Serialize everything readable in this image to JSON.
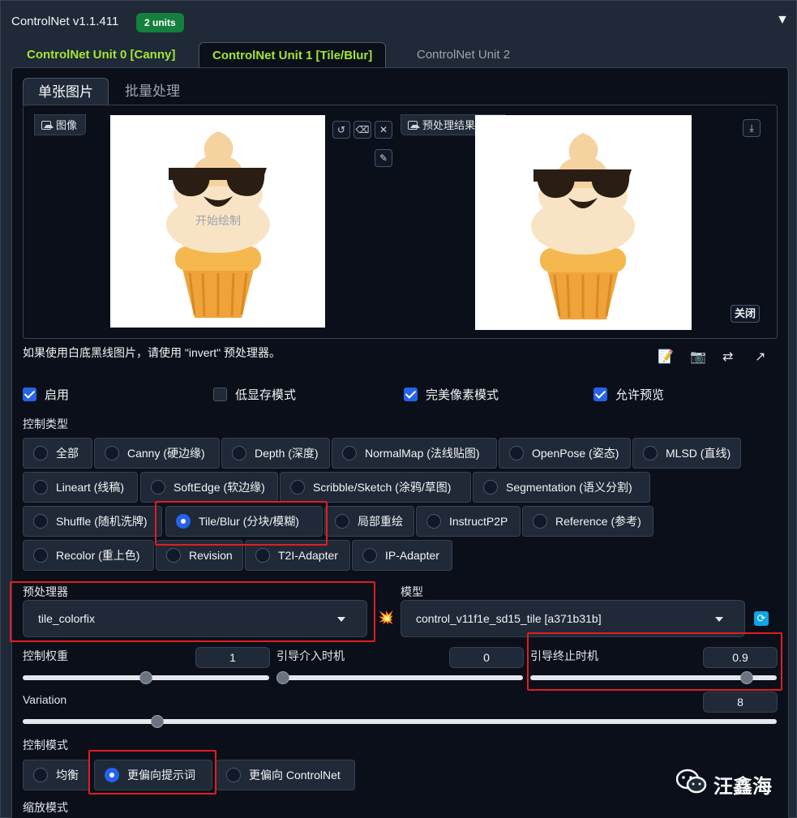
{
  "header": {
    "title": "ControlNet v1.1.411",
    "units_badge": "2 units",
    "collapse_icon": "▼"
  },
  "unit_tabs": [
    {
      "label": "ControlNet Unit 0 [Canny]"
    },
    {
      "label": "ControlNet Unit 1 [Tile/Blur]"
    },
    {
      "label": "ControlNet Unit 2"
    }
  ],
  "image_tabs": [
    {
      "label": "单张图片"
    },
    {
      "label": "批量处理"
    }
  ],
  "input_image": {
    "label": "图像",
    "hint": "开始绘制"
  },
  "preview_image": {
    "label": "预处理结果预览",
    "close_label": "关闭"
  },
  "hint_text": "如果使用白底黑线图片，请使用 \"invert\" 预处理器。",
  "checkboxes": [
    {
      "label": "启用",
      "checked": true
    },
    {
      "label": "低显存模式",
      "checked": false
    },
    {
      "label": "完美像素模式",
      "checked": true
    },
    {
      "label": "允许预览",
      "checked": true
    }
  ],
  "control_type": {
    "label": "控制类型",
    "selected": "Tile/Blur (分块/模糊)",
    "options": [
      "全部",
      "Canny (硬边缘)",
      "Depth (深度)",
      "NormalMap (法线贴图)",
      "OpenPose (姿态)",
      "MLSD (直线)",
      "Lineart (线稿)",
      "SoftEdge (软边缘)",
      "Scribble/Sketch (涂鸦/草图)",
      "Segmentation (语义分割)",
      "Shuffle (随机洗牌)",
      "Tile/Blur (分块/模糊)",
      "局部重绘",
      "InstructP2P",
      "Reference (参考)",
      "Recolor (重上色)",
      "Revision",
      "T2I-Adapter",
      "IP-Adapter"
    ]
  },
  "preprocessor": {
    "label": "预处理器",
    "value": "tile_colorfix"
  },
  "model": {
    "label": "模型",
    "value": "control_v11f1e_sd15_tile [a371b31b]"
  },
  "sliders": {
    "weight": {
      "label": "控制权重",
      "value": "1",
      "fraction": 0.5
    },
    "start": {
      "label": "引导介入时机",
      "value": "0",
      "fraction": 0.0
    },
    "end": {
      "label": "引导终止时机",
      "value": "0.9",
      "fraction": 0.9
    },
    "variation": {
      "label": "Variation",
      "value": "8",
      "fraction": 0.18
    }
  },
  "control_mode": {
    "label": "控制模式",
    "selected": "更偏向提示词",
    "options": [
      "均衡",
      "更偏向提示词",
      "更偏向 ControlNet"
    ]
  },
  "resize_mode": {
    "label": "缩放模式"
  },
  "watermark": {
    "text": "汪鑫海"
  },
  "colors": {
    "accent": "#2563eb",
    "tab_green": "#a3e635",
    "badge": "#15803d",
    "highlight": "#e11d21"
  }
}
